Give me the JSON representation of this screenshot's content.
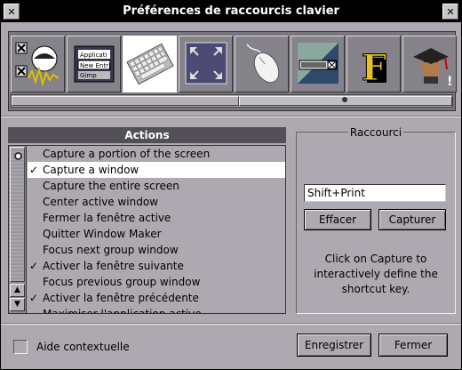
{
  "window": {
    "title": "Préférences de raccourcis clavier",
    "icon_left": "x-close-glyph",
    "icon_right": "x-close-glyph"
  },
  "icon_strip": {
    "items": [
      {
        "name": "wmaker-icon",
        "label": ""
      },
      {
        "name": "menu-editor-icon",
        "label": "",
        "menu_lines": [
          "Applicati",
          "New Entr|",
          "Gimp"
        ]
      },
      {
        "name": "keyboard-icon",
        "label": "",
        "selected": true
      },
      {
        "name": "window-resize-icon",
        "label": ""
      },
      {
        "name": "mouse-icon",
        "label": ""
      },
      {
        "name": "window-icon",
        "label": ""
      },
      {
        "name": "font-icon",
        "label": "",
        "letter": "F"
      },
      {
        "name": "expert-icon",
        "label": ""
      }
    ]
  },
  "actions": {
    "header": "Actions",
    "items": [
      {
        "label": "Capture a portion of the screen",
        "checked": false,
        "selected": false
      },
      {
        "label": "Capture a window",
        "checked": true,
        "selected": true
      },
      {
        "label": "Capture the entire screen",
        "checked": false,
        "selected": false
      },
      {
        "label": "Center active window",
        "checked": false,
        "selected": false
      },
      {
        "label": "Fermer la fenêtre active",
        "checked": false,
        "selected": false
      },
      {
        "label": "Quitter Window Maker",
        "checked": false,
        "selected": false
      },
      {
        "label": "Focus next group window",
        "checked": false,
        "selected": false
      },
      {
        "label": "Activer la fenêtre suivante",
        "checked": true,
        "selected": false
      },
      {
        "label": "Focus previous group window",
        "checked": false,
        "selected": false
      },
      {
        "label": "Activer la fenêtre précédente",
        "checked": true,
        "selected": false
      },
      {
        "label": "Maximiser l'application active",
        "checked": false,
        "selected": false
      }
    ],
    "check_glyph": "✓"
  },
  "raccourci": {
    "title": "Raccourci",
    "value": "Shift+Print",
    "clear_label": "Effacer",
    "capture_label": "Capturer",
    "help_text": "Click on Capture to interactively define the shortcut key."
  },
  "footer": {
    "context_help_label": "Aide contextuelle",
    "context_help_checked": false,
    "save_label": "Enregistrer",
    "close_label": "Fermer"
  },
  "colors": {
    "window_bg": "#aea9b1",
    "titlebar_bg": "#000000",
    "header_bg": "#545057",
    "selection_bg": "#ffffff"
  }
}
